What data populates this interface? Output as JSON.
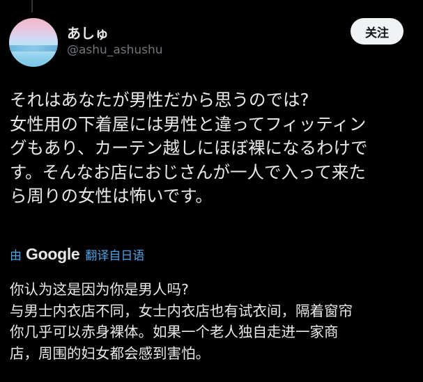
{
  "author": {
    "display_name": "あしゅ",
    "handle": "@ashu_ashushu"
  },
  "follow_button": {
    "label": "关注"
  },
  "post": {
    "text": "それはあなたが男性だから思うのでは?\n女性用の下着屋には男性と違ってフィッティン\nグもあり、カーテン越しにほぼ裸になるわけで\nす。そんなお店におじさんが一人で入って来た\nら周りの女性は怖いです。"
  },
  "translation": {
    "by_label": "由",
    "provider": "Google",
    "link_label": "翻译自日语",
    "text": "你认为这是因为你是男人吗?\n与男士内衣店不同，女士内衣店也有试衣间，隔着窗帘\n你几乎可以赤身裸体。如果一个老人独自走进一家商\n店，周围的妇女都会感到害怕。"
  },
  "colors": {
    "background": "#000000",
    "text_primary": "#e7e9ea",
    "text_secondary": "#71767b",
    "link": "#4ca3e7",
    "follow_bg": "#eff3f4"
  }
}
